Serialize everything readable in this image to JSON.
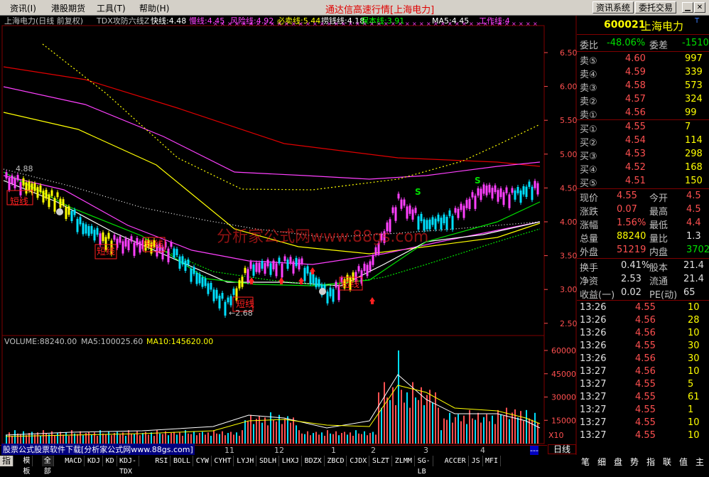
{
  "menu": {
    "items": [
      "资讯(I)",
      "港股期货",
      "工具(T)",
      "帮助(H)"
    ],
    "title": "通达信高速行情[上海电力]",
    "btn_info": "资讯系统",
    "btn_trade": "委托交易"
  },
  "chart": {
    "title": "上海电力(日线 前复权)",
    "indicator_name": "TDX攻防六线Z",
    "indicators": [
      {
        "label": "快线:4.48",
        "color": "#ffffff"
      },
      {
        "label": "慢线:4.45",
        "color": "#ff40ff"
      },
      {
        "label": "风险线:4.92",
        "color": "#ff40ff"
      },
      {
        "label": "必卖线:5.44",
        "color": "#ffff00"
      },
      {
        "label": "捞钱线:4.18",
        "color": "#ffffff"
      },
      {
        "label": "保本线:3.91",
        "color": "#00ff00"
      },
      {
        "label": "MA5:4.45",
        "color": "#ffffff"
      },
      {
        "label": "工作线:4",
        "color": "#ff40ff"
      }
    ],
    "price_axis": [
      "6.50",
      "6.00",
      "5.50",
      "5.00",
      "4.50",
      "4.00",
      "3.50",
      "3.00",
      "2.50"
    ],
    "high_mark": "4.88",
    "low_mark": "←2.68",
    "short_labels": [
      "短线",
      "短线",
      "短线",
      "短线",
      "短线"
    ],
    "buy_sell_marks": [
      "S",
      "S"
    ],
    "watermark": "分析家公式网www.88gs.com",
    "volume_header": {
      "volume": "VOLUME:88240.00",
      "ma5": "MA5:100025.60",
      "ma10": "MA10:145620.00"
    },
    "volume_axis": [
      "60000",
      "45000",
      "30000",
      "15000"
    ],
    "volume_unit": "X10",
    "months": [
      "11",
      "12",
      "1",
      "2",
      "3",
      "4"
    ],
    "ad_text": "股票公式股票软件下载[分析家公式网www.88gs.com]",
    "period": "日线"
  },
  "quote": {
    "code": "600021",
    "name": "上海电力",
    "t_mark": "T",
    "webi": {
      "label": "委比",
      "value": "-48.06%",
      "label2": "委差",
      "value2": "-1510"
    },
    "asks": [
      {
        "label": "卖⑤",
        "price": "4.60",
        "vol": "997"
      },
      {
        "label": "卖④",
        "price": "4.59",
        "vol": "339"
      },
      {
        "label": "卖③",
        "price": "4.58",
        "vol": "573"
      },
      {
        "label": "卖②",
        "price": "4.57",
        "vol": "324"
      },
      {
        "label": "卖①",
        "price": "4.56",
        "vol": "99"
      }
    ],
    "bids": [
      {
        "label": "买①",
        "price": "4.55",
        "vol": "7"
      },
      {
        "label": "买②",
        "price": "4.54",
        "vol": "114"
      },
      {
        "label": "买③",
        "price": "4.53",
        "vol": "298"
      },
      {
        "label": "买④",
        "price": "4.52",
        "vol": "168"
      },
      {
        "label": "买⑤",
        "price": "4.51",
        "vol": "150"
      }
    ],
    "stats": [
      {
        "l1": "现价",
        "v1": "4.55",
        "c1": "red",
        "l2": "今开",
        "v2": "4.5",
        "c2": "red"
      },
      {
        "l1": "涨跌",
        "v1": "0.07",
        "c1": "red",
        "l2": "最高",
        "v2": "4.5",
        "c2": "red"
      },
      {
        "l1": "涨幅",
        "v1": "1.56%",
        "c1": "red",
        "l2": "最低",
        "v2": "4.4",
        "c2": "red"
      },
      {
        "l1": "总量",
        "v1": "88240",
        "c1": "yellow",
        "l2": "量比",
        "v2": "1.3",
        "c2": "white"
      },
      {
        "l1": "外盘",
        "v1": "51219",
        "c1": "red",
        "l2": "内盘",
        "v2": "3702",
        "c2": "green"
      }
    ],
    "stats2": [
      {
        "l1": "换手",
        "v1": "0.41%",
        "l2": "股本",
        "v2": "21.4"
      },
      {
        "l1": "净资",
        "v1": "2.53",
        "l2": "流通",
        "v2": "21.4"
      },
      {
        "l1": "收益(一)",
        "v1": "0.02",
        "l2": "PE(动)",
        "v2": "65"
      }
    ],
    "ticks": [
      {
        "time": "13:26",
        "price": "4.55",
        "pc": "red",
        "vol": "10",
        "vc": "yellow"
      },
      {
        "time": "13:26",
        "price": "4.56",
        "pc": "red",
        "vol": "28",
        "vc": "yellow"
      },
      {
        "time": "13:26",
        "price": "4.56",
        "pc": "red",
        "vol": "10",
        "vc": "yellow"
      },
      {
        "time": "13:26",
        "price": "4.55",
        "pc": "red",
        "vol": "30",
        "vc": "yellow"
      },
      {
        "time": "13:26",
        "price": "4.56",
        "pc": "red",
        "vol": "30",
        "vc": "yellow"
      },
      {
        "time": "13:27",
        "price": "4.56",
        "pc": "red",
        "vol": "10",
        "vc": "yellow"
      },
      {
        "time": "13:27",
        "price": "4.55",
        "pc": "red",
        "vol": "5",
        "vc": "yellow"
      },
      {
        "time": "13:27",
        "price": "4.55",
        "pc": "red",
        "vol": "61",
        "vc": "yellow"
      },
      {
        "time": "13:27",
        "price": "4.55",
        "pc": "red",
        "vol": "1",
        "vc": "yellow"
      },
      {
        "time": "13:27",
        "price": "4.55",
        "pc": "red",
        "vol": "10",
        "vc": "yellow"
      },
      {
        "time": "13:27",
        "price": "4.55",
        "pc": "red",
        "vol": "10",
        "vc": "yellow"
      }
    ]
  },
  "tabs": [
    "指标",
    "模板",
    "全部",
    "MACD",
    "KDJ",
    "KD",
    "KDJ-TDX",
    "RSI",
    "BOLL",
    "CYW",
    "CYHT",
    "LYJH",
    "SDLH",
    "LHXJ",
    "BDZX",
    "ZBCD",
    "CJDX",
    "SLZT",
    "ZLMM",
    "SG-LB",
    "ACCER",
    "JS",
    "MFI"
  ],
  "right_tabs": [
    "笔",
    "细",
    "盘",
    "势",
    "指",
    "联",
    "值",
    "主"
  ],
  "colors": {
    "up": "#ff5050",
    "down": "#00e0ff",
    "bg": "#000000",
    "grid": "#800000"
  }
}
